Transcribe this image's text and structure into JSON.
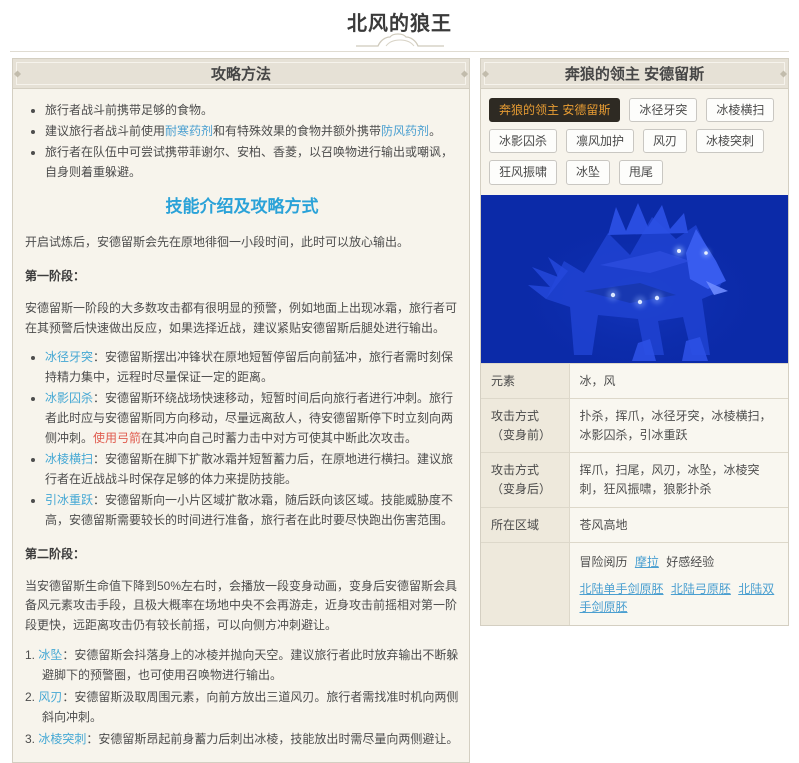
{
  "colors": {
    "heading_blue": "#2aa2d8",
    "link_blue": "#4a9fd0",
    "term_cyan": "#45a8d4",
    "highlight_red": "#e05c4f",
    "selected_tag_bg": "#2e2a23",
    "selected_tag_text": "#e79c33",
    "panel_header_bg": "#e6e1d6",
    "panel_body_bg": "#f7f4ec",
    "image_bg": "#0b2aa8"
  },
  "page": {
    "title": "北风的狼王"
  },
  "left_panel": {
    "title": "攻略方法",
    "b1": "旅行者战斗前携带足够的食物。",
    "b2a": "建议旅行者战斗前使用",
    "b2_link1": "耐寒药剂",
    "b2b": "和有特殊效果的食物并额外携带",
    "b2_link2": "防风药剂",
    "b2c": "。",
    "b3": "旅行者在队伍中可尝试携带菲谢尔、安柏、香菱，以召唤物进行输出或嘲讽，自身则着重躲避。",
    "section_heading": "技能介绍及攻略方式",
    "intro": "开启试炼后，安德留斯会先在原地徘徊一小段时间，此时可以放心输出。",
    "phase1_label": "第一阶段：",
    "phase1_desc": "安德留斯一阶段的大多数攻击都有很明显的预警，例如地面上出现冰霜，旅行者可在其预警后快速做出反应，如果选择近战，建议紧贴安德留斯后腿处进行输出。",
    "skills": [
      {
        "term": "冰径牙突",
        "desc": "：安德留斯摆出冲锋状在原地短暂停留后向前猛冲，旅行者需时刻保持精力集中，远程时尽量保证一定的距离。"
      },
      {
        "term": "冰影囚杀",
        "desc": "：安德留斯环绕战场快速移动，短暂时间后向旅行者进行冲刺。旅行者此时应与安德留斯同方向移动，尽量远离敌人，待安德留斯停下时立刻向两侧冲刺。",
        "red": "使用弓箭",
        "desc2": "在其冲向自己时蓄力击中对方可使其中断此次攻击。"
      },
      {
        "term": "冰棱横扫",
        "desc": "：安德留斯在脚下扩散冰霜并短暂蓄力后，在原地进行横扫。建议旅行者在近战战斗时保存足够的体力来提防技能。"
      },
      {
        "term": "引冰重跃",
        "desc": "：安德留斯向一小片区域扩散冰霜，随后跃向该区域。技能威胁度不高，安德留斯需要较长的时间进行准备，旅行者在此时要尽快跑出伤害范围。"
      }
    ],
    "phase2_label": "第二阶段：",
    "phase2_desc": "当安德留斯生命值下降到50%左右时，会播放一段变身动画，变身后安德留斯会具备风元素攻击手段，且极大概率在场地中央不会再游走，近身攻击前摇相对第一阶段更快，远距离攻击仍有较长前摇，可以向侧方冲刺避让。",
    "numbered": [
      {
        "num": "1.",
        "term": "冰坠",
        "desc": "：安德留斯会抖落身上的冰棱并抛向天空。建议旅行者此时放弃输出不断躲避脚下的预警圈，也可使用召唤物进行输出。"
      },
      {
        "num": "2.",
        "term": "风刃",
        "desc": "：安德留斯汲取周围元素，向前方放出三道风刃。旅行者需找准时机向两侧斜向冲刺。"
      },
      {
        "num": "3.",
        "term": "冰棱突刺",
        "desc": "：安德留斯昂起前身蓄力后刺出冰棱，技能放出时需尽量向两侧避让。"
      }
    ]
  },
  "right_panel": {
    "title": "奔狼的领主 安德留斯",
    "tags": [
      "奔狼的领主 安德留斯",
      "冰径牙突",
      "冰棱横扫",
      "冰影囚杀",
      "凛风加护",
      "风刃",
      "冰棱突刺",
      "狂风振啸",
      "冰坠",
      "甩尾"
    ],
    "image_alt": "安德留斯（蓝色幽狼立绘）",
    "rows": [
      {
        "label": "元素",
        "value": "冰，风"
      },
      {
        "label": "攻击方式（变身前）",
        "value": "扑杀，挥爪，冰径牙突，冰棱横扫，冰影囚杀，引冰重跃"
      },
      {
        "label": "攻击方式（变身后）",
        "value": "挥爪，扫尾，风刃，冰坠，冰棱突刺，狂风振啸，狼影扑杀"
      },
      {
        "label": "所在区域",
        "value": "苍风高地"
      }
    ],
    "rewards": {
      "r1a": "冒险阅历",
      "r1b": "摩拉",
      "r1c": "好感经验",
      "r2a": "北陆单手剑原胚",
      "r2b": "北陆弓原胚",
      "r2c": "北陆双手剑原胚"
    }
  }
}
